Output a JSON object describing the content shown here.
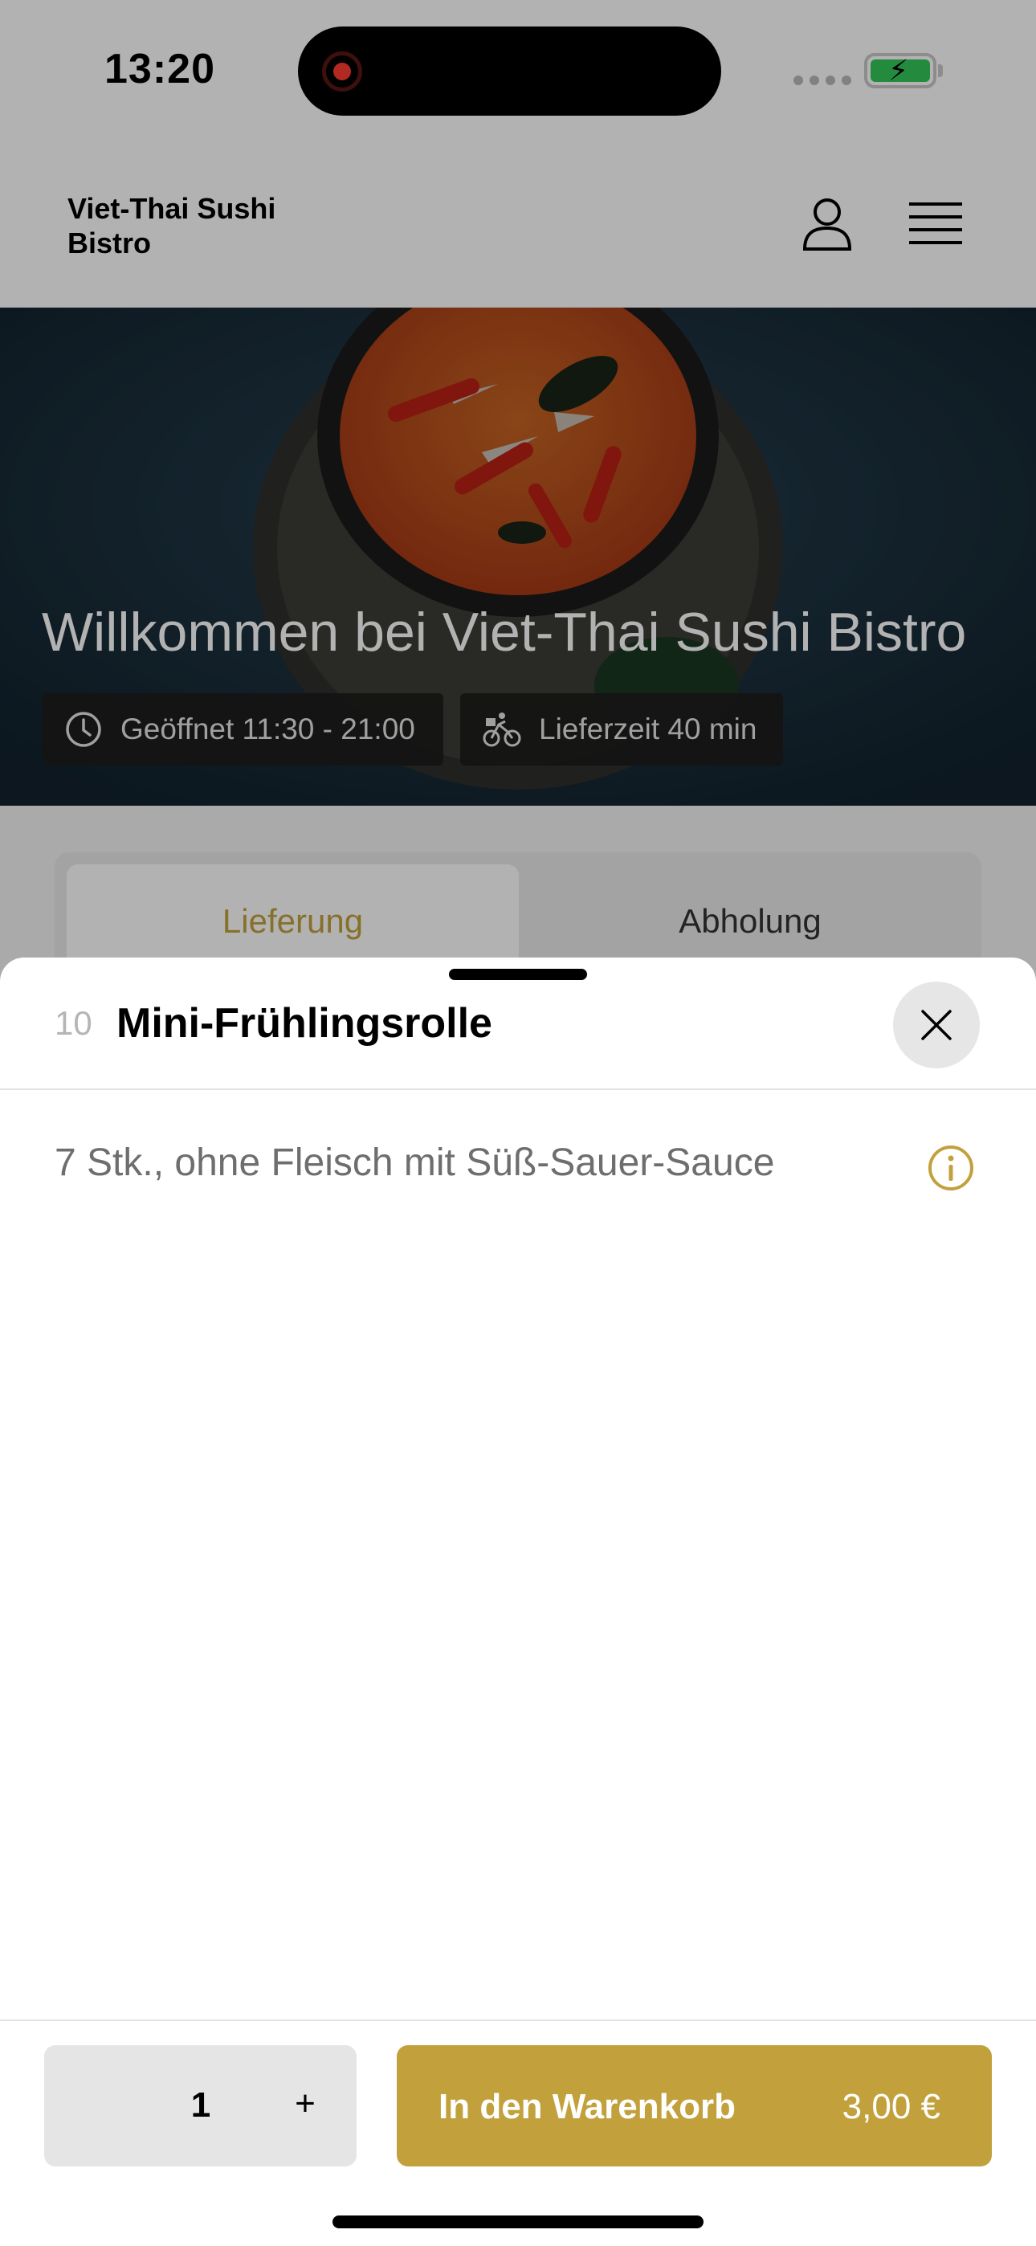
{
  "status_bar": {
    "time": "13:20"
  },
  "header": {
    "brand": "Viet-Thai Sushi Bistro"
  },
  "hero": {
    "title": "Willkommen bei Viet-Thai Sushi Bistro",
    "opening_hours": "Geöffnet 11:30 - 21:00",
    "delivery_time": "Lieferzeit 40 min"
  },
  "order_mode": {
    "tabs": [
      "Lieferung",
      "Abholung"
    ],
    "active": "Lieferung"
  },
  "sheet": {
    "item_number": "10",
    "item_name": "Mini-Frühlingsrolle",
    "description": "7 Stk., ohne Fleisch mit Süß-Sauer-Sauce"
  },
  "footer": {
    "quantity": "1",
    "plus_label": "+",
    "add_to_cart_label": "In den Warenkorb",
    "price": "3,00 €"
  },
  "colors": {
    "accent": "#c2a13d",
    "scrim": "rgba(0,0,0,0.30)"
  },
  "icons": [
    "record-icon",
    "battery-icon",
    "user-icon",
    "menu-icon",
    "clock-icon",
    "bike-icon",
    "close-icon",
    "info-icon"
  ]
}
